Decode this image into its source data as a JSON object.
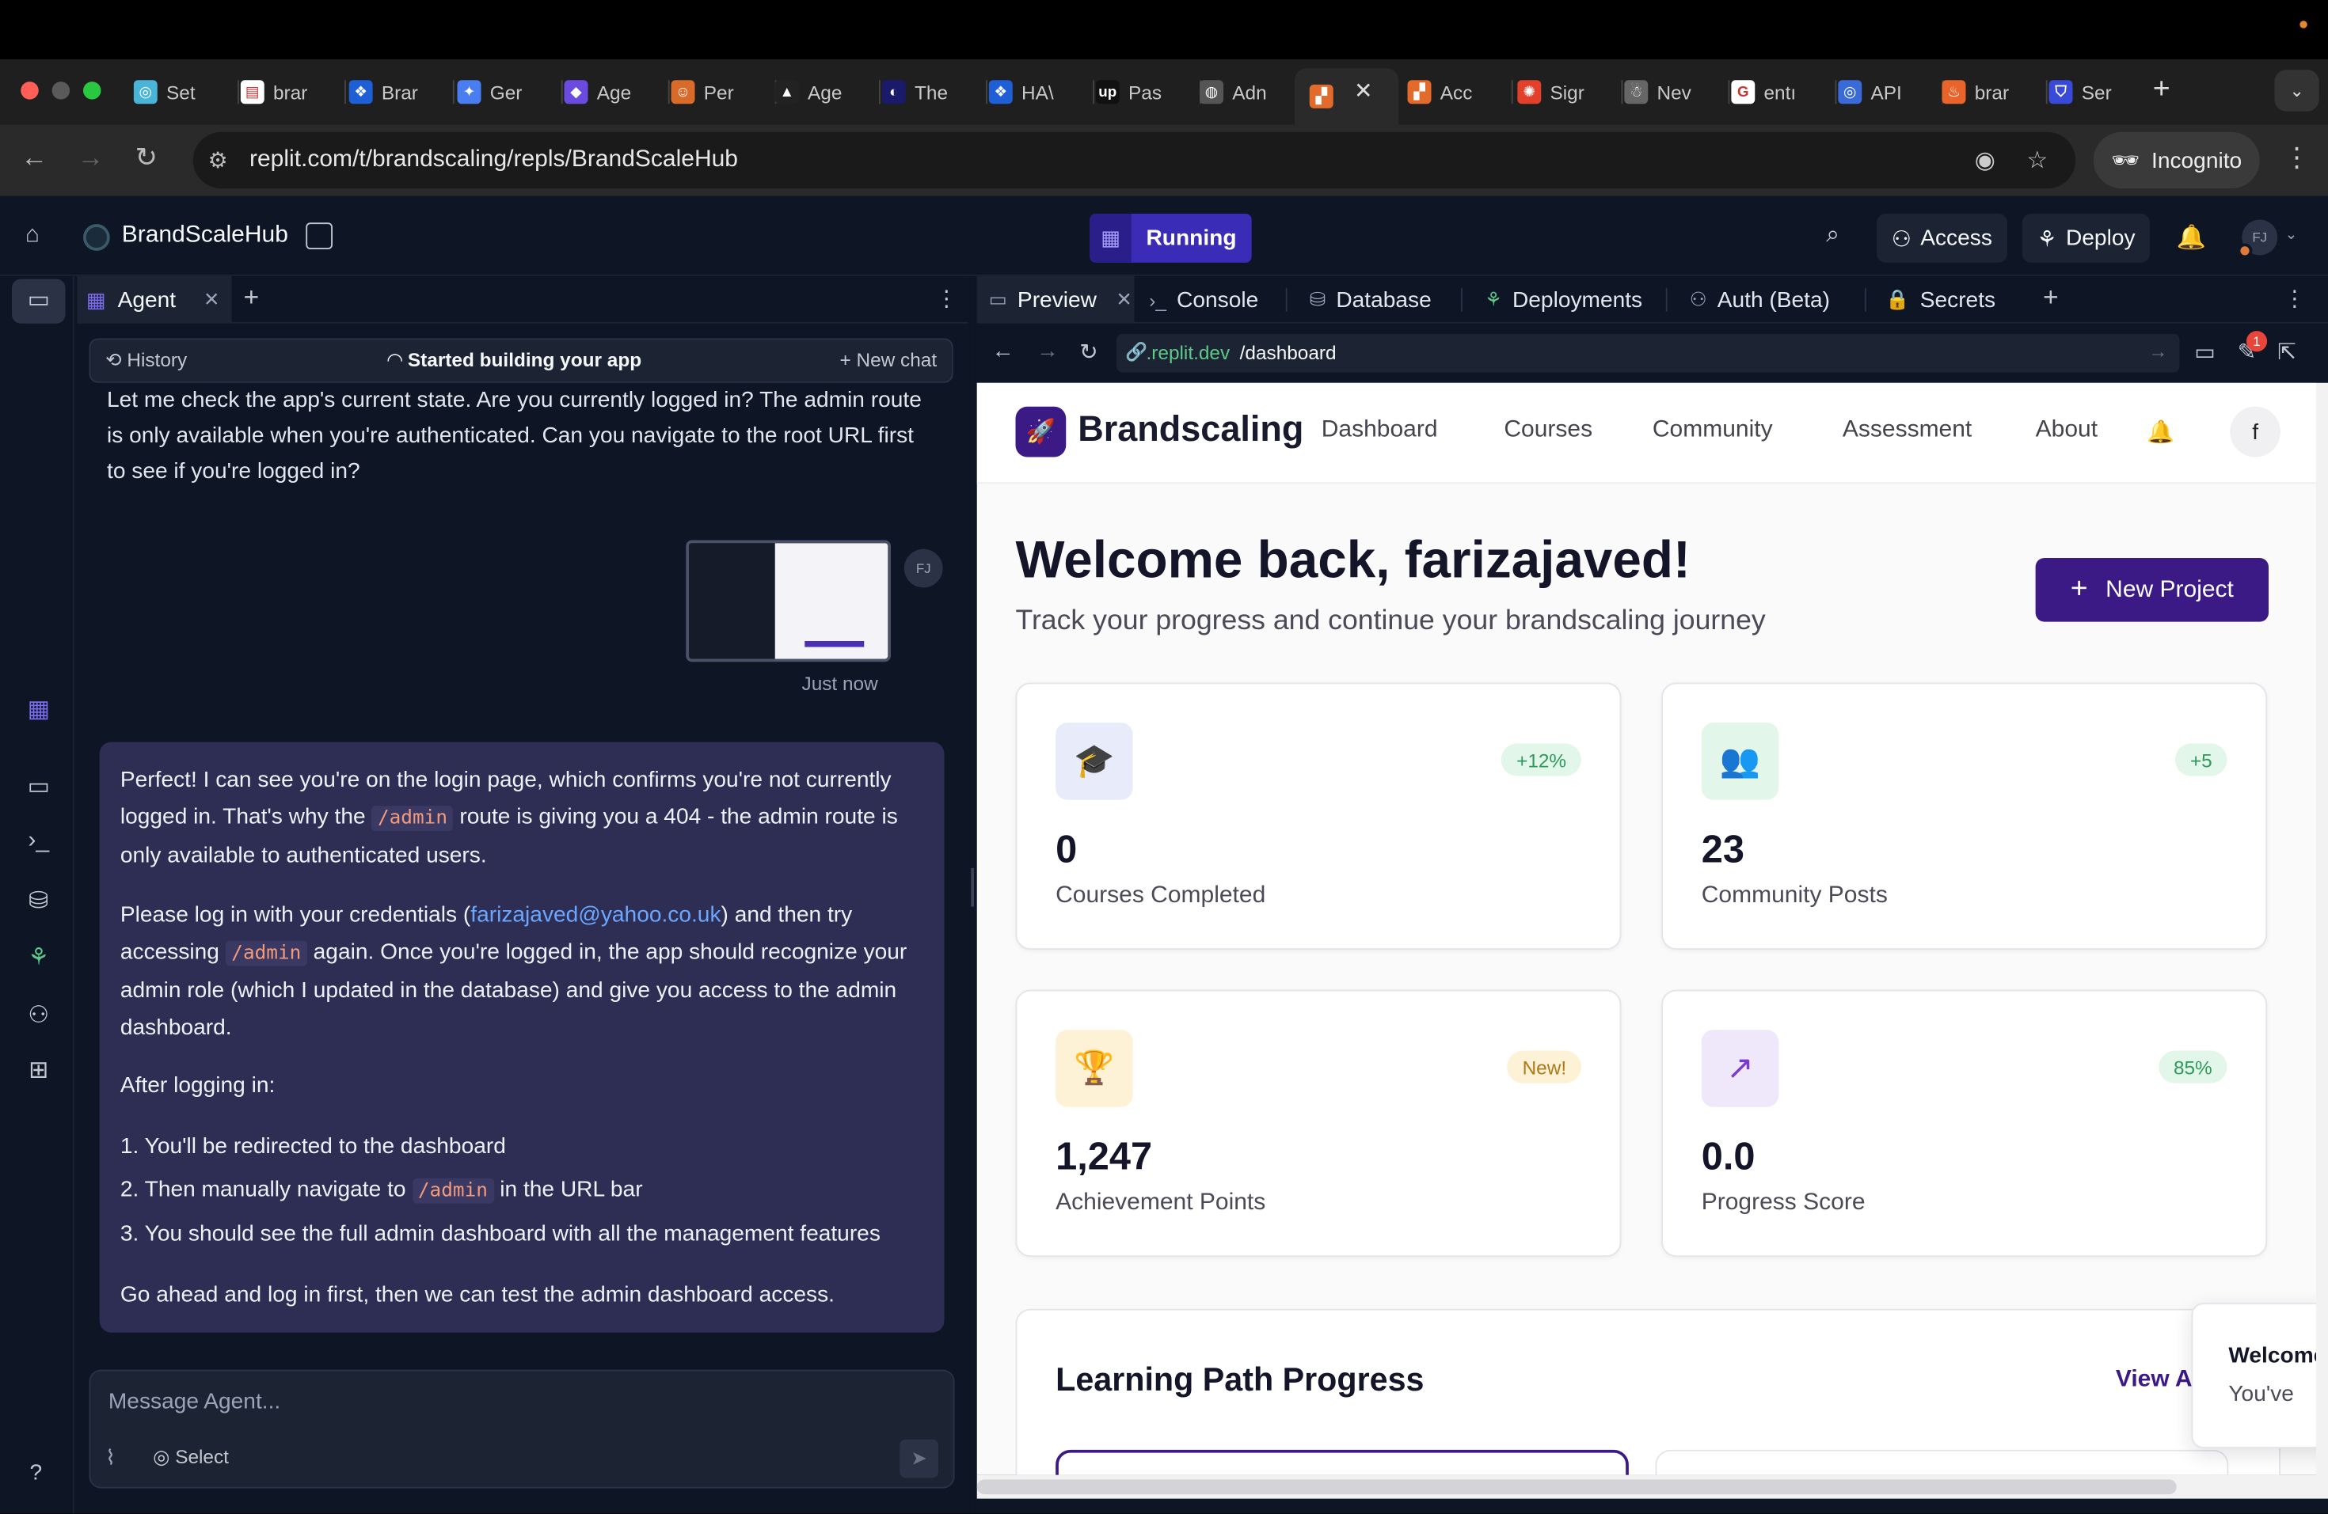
{
  "browser": {
    "tabs": [
      {
        "label": "Set",
        "color": "#4ab3d8",
        "glyph": "◎"
      },
      {
        "label": "brar",
        "color": "#ffffff",
        "glyph": "▤"
      },
      {
        "label": "Brar",
        "color": "#1e5fd6",
        "glyph": "❖"
      },
      {
        "label": "Ger",
        "color": "#4a7ef0",
        "glyph": "✦"
      },
      {
        "label": "Age",
        "color": "#6b4ae0",
        "glyph": "◆"
      },
      {
        "label": "Per",
        "color": "#d86a2a",
        "glyph": "☺"
      },
      {
        "label": "Age",
        "color": "#222222",
        "glyph": "▲"
      },
      {
        "label": "The",
        "color": "#1a1a6a",
        "glyph": "◐"
      },
      {
        "label": "HA\\",
        "color": "#1e5fd6",
        "glyph": "❖"
      },
      {
        "label": "Pas",
        "color": "#111111",
        "glyph": "up"
      },
      {
        "label": "Adn",
        "color": "#555555",
        "glyph": "◍"
      },
      {
        "label": "",
        "color": "#e26a2a",
        "glyph": "▞"
      },
      {
        "label": "Acc",
        "color": "#e26a2a",
        "glyph": "▞"
      },
      {
        "label": "Sigr",
        "color": "#e2402a",
        "glyph": "✺"
      },
      {
        "label": "Nev",
        "color": "#666666",
        "glyph": "☃"
      },
      {
        "label": "entı",
        "color": "#ffffff",
        "glyph": "G"
      },
      {
        "label": "API",
        "color": "#3a6ad8",
        "glyph": "◎"
      },
      {
        "label": "brar",
        "color": "#e8642a",
        "glyph": "♨"
      },
      {
        "label": "Ser",
        "color": "#3a4ad8",
        "glyph": "⛉"
      }
    ],
    "url": "replit.com/t/brandscaling/repls/BrandScaleHub",
    "incognito_label": "Incognito"
  },
  "replit": {
    "project_name": "BrandScaleHub",
    "status": "Running",
    "access_label": "Access",
    "deploy_label": "Deploy",
    "avatar_initials": "FJ"
  },
  "agent": {
    "tab_label": "Agent",
    "history_label": "History",
    "status_label": "Started building your app",
    "new_chat_label": "New chat",
    "message_1": "Let me check the app's current state. Are you currently logged in? The admin route is only available when you're authenticated. Can you navigate to the root URL first to see if you're logged in?",
    "user_avatar": "FJ",
    "timestamp": "Just now",
    "reply": {
      "p1_a": "Perfect! I can see you're on the login page, which confirms you're not currently logged in. That's why the",
      "p1_code": "/admin",
      "p1_b": "route is giving you a 404 - the admin route is only available to authenticated users.",
      "p2_a": "Please log in with your credentials (",
      "p2_email": "farizajaved@yahoo.co.uk",
      "p2_b": ") and then try accessing",
      "p2_code": "/admin",
      "p2_c": "again. Once you're logged in, the app should recognize your admin role (which I updated in the database) and give you access to the admin dashboard.",
      "p3": "After logging in:",
      "step1": "1. You'll be redirected to the dashboard",
      "step2_a": "2. Then manually navigate to",
      "step2_code": "/admin",
      "step2_b": "in the URL bar",
      "step3": "3. You should see the full admin dashboard with all the management features",
      "p4": "Go ahead and log in first, then we can test the admin dashboard access."
    },
    "composer_placeholder": "Message Agent...",
    "select_label": "Select"
  },
  "workspace_tabs": {
    "preview": "Preview",
    "console": "Console",
    "database": "Database",
    "deployments": "Deployments",
    "auth": "Auth (Beta)",
    "secrets": "Secrets"
  },
  "preview": {
    "url_domain": ".replit.dev",
    "url_path": "/dashboard",
    "notification_count": "1"
  },
  "app": {
    "brand": "Brandscaling",
    "nav": [
      "Dashboard",
      "Courses",
      "Community",
      "Assessment",
      "About"
    ],
    "user_initial": "f",
    "welcome": "Welcome back, farizajaved!",
    "subtitle": "Track your progress and continue your brandscaling journey",
    "new_project_label": "New Project",
    "cards": [
      {
        "value": "0",
        "label": "Courses Completed",
        "badge": "+12%",
        "icon": "graduation-cap-icon",
        "icon_bg": "#e8ecfa",
        "icon_color": "#3b3b6e",
        "badge_bg": "#e3f6ea",
        "badge_color": "#2e9a5a"
      },
      {
        "value": "23",
        "label": "Community Posts",
        "badge": "+5",
        "icon": "users-icon",
        "icon_bg": "#e3f6ea",
        "icon_color": "#2e9a5a",
        "badge_bg": "#e3f6ea",
        "badge_color": "#2e9a5a"
      },
      {
        "value": "1,247",
        "label": "Achievement Points",
        "badge": "New!",
        "icon": "trophy-icon",
        "icon_bg": "#fdf1d6",
        "icon_color": "#b07a1a",
        "badge_bg": "#fdf1d6",
        "badge_color": "#b07a1a"
      },
      {
        "value": "0.0",
        "label": "Progress Score",
        "badge": "85%",
        "icon": "trending-up-icon",
        "icon_bg": "#efe8fb",
        "icon_color": "#7a3ad0",
        "badge_bg": "#e3f6ea",
        "badge_color": "#2e9a5a"
      }
    ],
    "learning_path_title": "Learning Path Progress",
    "view_all_label": "View All",
    "toast_title": "Welcome",
    "toast_body": "You've"
  }
}
